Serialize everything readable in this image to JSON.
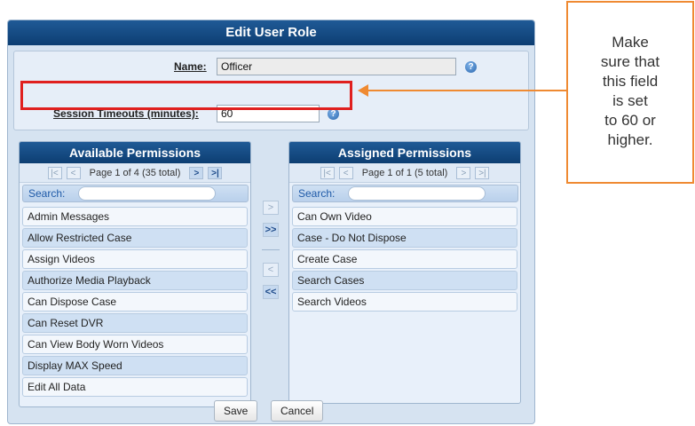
{
  "dialog": {
    "title": "Edit User Role",
    "name_label": "Name:",
    "name_value": "Officer",
    "timeout_label": "Session Timeouts (minutes):",
    "timeout_value": "60",
    "help_icon": "help-icon",
    "save_label": "Save",
    "cancel_label": "Cancel"
  },
  "available": {
    "title": "Available Permissions",
    "pager_text": "Page 1 of 4 (35 total)",
    "search_label": "Search:",
    "items": [
      "Admin Messages",
      "Allow Restricted Case",
      "Assign Videos",
      "Authorize Media Playback",
      "Can Dispose Case",
      "Can Reset DVR",
      "Can View Body Worn Videos",
      "Display MAX Speed",
      "Edit All Data"
    ]
  },
  "assigned": {
    "title": "Assigned Permissions",
    "pager_text": "Page 1 of 1 (5 total)",
    "search_label": "Search:",
    "items": [
      "Can Own Video",
      "Case - Do Not Dispose",
      "Create Case",
      "Search Cases",
      "Search Videos"
    ]
  },
  "transfer": {
    "add_one": ">",
    "add_all": ">>",
    "remove_one": "<",
    "remove_all": "<<"
  },
  "pager_glyphs": {
    "first": "|<",
    "prev": "<",
    "next": ">",
    "last": ">|"
  },
  "callout": {
    "text": "Make\nsure that\nthis field\nis set\nto 60 or\nhigher."
  },
  "colors": {
    "header": "#0d3e72",
    "highlight": "#e0201f",
    "callout": "#ef8a32"
  }
}
